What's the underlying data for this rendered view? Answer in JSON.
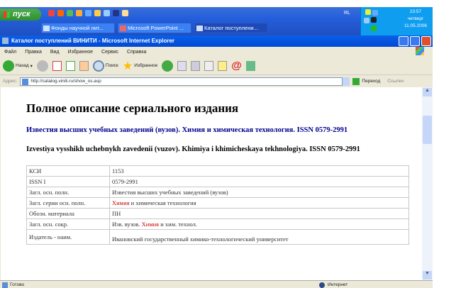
{
  "taskbar": {
    "start_label": "пуск",
    "tasks": [
      "Фонды научной лит...",
      "Microsoft PowerPoint ...",
      "Каталог поступлени..."
    ],
    "language": "RL",
    "clock": {
      "time": "23:57",
      "day": "четверг",
      "date": "11.05.2006"
    }
  },
  "window": {
    "title": "Каталог поступлений ВИНИТИ - Microsoft Internet Explorer"
  },
  "menu": [
    "Файл",
    "Правка",
    "Вид",
    "Избранное",
    "Сервис",
    "Справка"
  ],
  "toolbar": {
    "back": "Назад",
    "search": "Поиск",
    "favorites": "Избранное"
  },
  "address": {
    "label": "Адрес:",
    "url": "http://catalog.viniti.ru/show_os.asp",
    "go": "Переход",
    "links": "Ссылки"
  },
  "page": {
    "heading": "Полное описание сериального издания",
    "title_ru": "Известия высших учебных заведений (вузов). Химия и химическая технология. ISSN 0579-2991",
    "title_en": "Izvestiya vysshikh uchebnykh zavedenii (vuzov). Khimiya i khimicheskaya tekhnologiya. ISSN 0579-2991",
    "rows": [
      {
        "key": "КСИ",
        "value": "1153"
      },
      {
        "key": "ISSN I",
        "value": "0579-2991"
      },
      {
        "key": "Загл. осн. полн.",
        "value": "Известия высших учебных заведений (вузов)"
      },
      {
        "key": "Загл. серии осн. полн.",
        "hl": "Химия",
        "value": " и химическая технология"
      },
      {
        "key": "Обозн. материала",
        "value": "ПН"
      },
      {
        "key": "Загл. осн. сокр.",
        "pre": "Изв. вузов. ",
        "hl": "Химия",
        "value": " и хим. технол."
      },
      {
        "key": "Издатель - наим.",
        "value": "Ивановский государственный химико-технологический университет"
      }
    ]
  },
  "status": {
    "left": "Готово",
    "zone": "Интернет"
  }
}
